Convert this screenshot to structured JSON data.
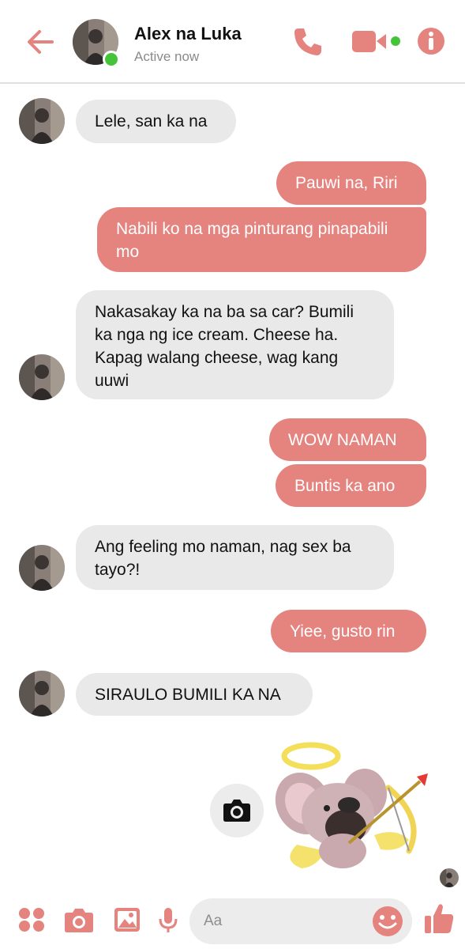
{
  "header": {
    "contact_name": "Alex na Luka",
    "status": "Active now"
  },
  "messages": [
    {
      "side": "received",
      "text": "Lele, san ka na"
    },
    {
      "side": "sent",
      "text": "Pauwi na, Riri"
    },
    {
      "side": "sent",
      "text": "Nabili ko na mga pinturang pinapabili mo"
    },
    {
      "side": "received",
      "text": "Nakasakay ka na ba sa car? Bumili ka nga ng ice cream. Cheese ha. Kapag walang cheese, wag kang uuwi"
    },
    {
      "side": "sent",
      "text": "WOW NAMAN"
    },
    {
      "side": "sent",
      "text": "Buntis ka ano"
    },
    {
      "side": "received",
      "text": "Ang feeling mo naman, nag sex ba tayo?!"
    },
    {
      "side": "sent",
      "text": "Yiee, gusto rin"
    },
    {
      "side": "received",
      "text": "SIRAULO BUMILI KA NA"
    }
  ],
  "sticker": {
    "description_icon": "cupid-mouse-sticker"
  },
  "composer": {
    "placeholder": "Aa"
  },
  "colors": {
    "accent": "#e5837f",
    "received_bubble": "#e9e9e9",
    "online": "#45c43a"
  }
}
